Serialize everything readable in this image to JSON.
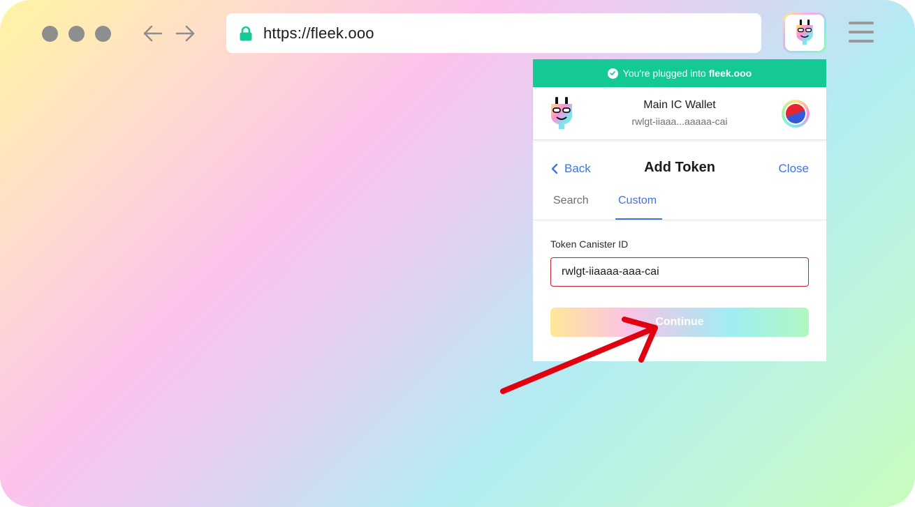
{
  "browser": {
    "url": "https://fleek.ooo",
    "icons": {
      "traffic_lights": "window-control-dots",
      "back": "arrow-left-icon",
      "forward": "arrow-right-icon",
      "lock": "lock-icon",
      "extension": "plug-extension-icon",
      "menu": "hamburger-menu-icon"
    }
  },
  "popup": {
    "banner": {
      "text": "You're plugged into",
      "domain": "fleek.ooo",
      "icon": "check-circle-icon",
      "color": "#14c996"
    },
    "wallet": {
      "name": "Main IC Wallet",
      "address": "rwlgt-iiaaa...aaaaa-cai"
    },
    "nav": {
      "back_label": "Back",
      "title": "Add Token",
      "close_label": "Close"
    },
    "tabs": [
      {
        "label": "Search",
        "active": false
      },
      {
        "label": "Custom",
        "active": true
      }
    ],
    "form": {
      "label": "Token Canister ID",
      "value": "rwlgt-iiaaaa-aaa-cai",
      "submit_label": "Continue"
    },
    "accent_color": "#3f74e0"
  },
  "annotation": {
    "type": "arrow",
    "color": "#e0000f",
    "points_to": "continue-button"
  }
}
